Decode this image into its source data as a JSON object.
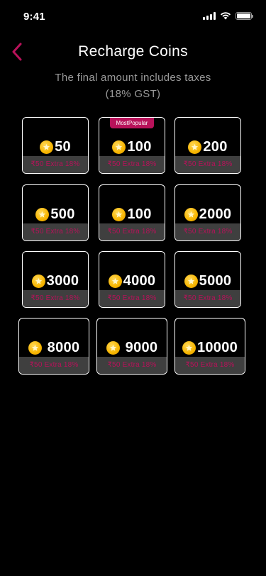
{
  "status_bar": {
    "time": "9:41"
  },
  "header": {
    "title": "Recharge Coins",
    "subtitle_line1": "The final amount includes taxes",
    "subtitle_line2": "(18% GST)"
  },
  "colors": {
    "accent": "#b8125a",
    "coin": "#f7b500",
    "card_footer": "#3f3f3f"
  },
  "badge_label": "MostPopular",
  "packs": [
    {
      "amount": "50",
      "extra": "₹50 Extra 18%"
    },
    {
      "amount": "100",
      "extra": "₹50 Extra 18%",
      "badge": "MostPopular"
    },
    {
      "amount": "200",
      "extra": "₹50 Extra 18%"
    },
    {
      "amount": "500",
      "extra": "₹50 Extra 18%"
    },
    {
      "amount": "100",
      "extra": "₹50 Extra 18%"
    },
    {
      "amount": "2000",
      "extra": "₹50 Extra 18%"
    },
    {
      "amount": "3000",
      "extra": "₹50 Extra 18%"
    },
    {
      "amount": "4000",
      "extra": "₹50 Extra 18%"
    },
    {
      "amount": "5000",
      "extra": "₹50 Extra 18%"
    },
    {
      "amount": "8000",
      "extra": "₹50 Extra 18%"
    },
    {
      "amount": "9000",
      "extra": "₹50 Extra 18%"
    },
    {
      "amount": "10000",
      "extra": "₹50 Extra 18%"
    }
  ]
}
